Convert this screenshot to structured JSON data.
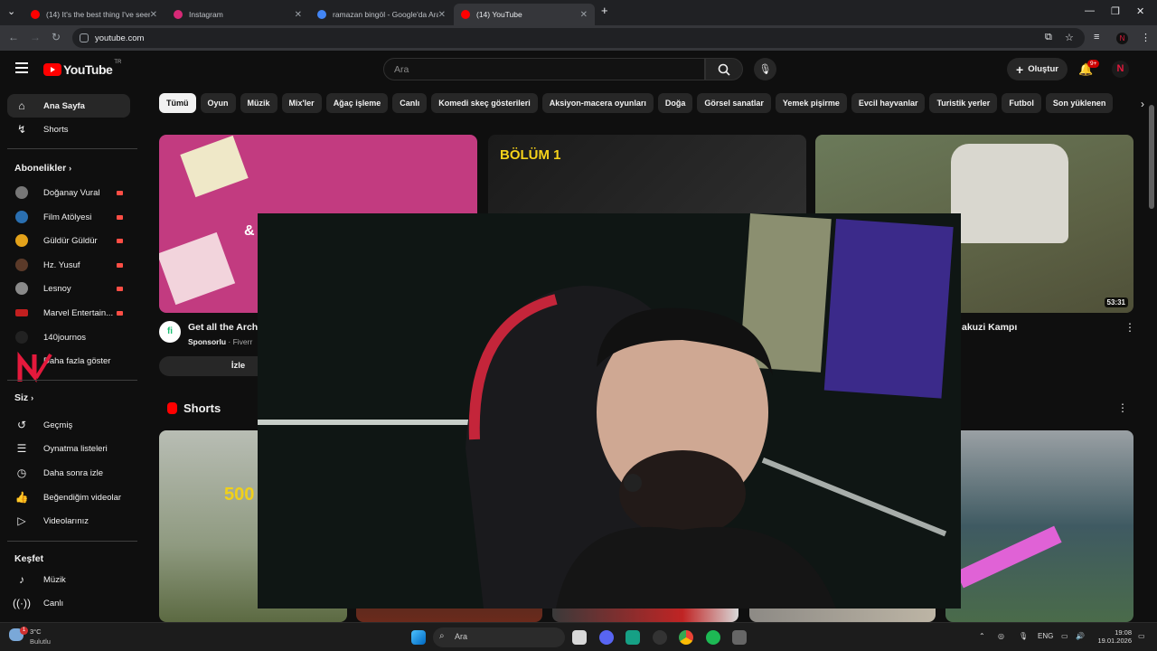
{
  "browser": {
    "tabs": [
      {
        "title": "(14) It's the best thing I've seen",
        "favicon_color": "#ff0000",
        "active": false
      },
      {
        "title": "Instagram",
        "favicon_color": "#d62976",
        "active": false
      },
      {
        "title": "ramazan bingöl - Google'da Ara",
        "favicon_color": "#4285f4",
        "active": false
      },
      {
        "title": "(14) YouTube",
        "favicon_color": "#ff0000",
        "active": true
      }
    ],
    "url": "youtube.com"
  },
  "youtube": {
    "logo": "YouTube",
    "country": "TR",
    "search_placeholder": "Ara",
    "create_label": "Oluştur",
    "notification_badge": "9+",
    "chips": [
      "Tümü",
      "Oyun",
      "Müzik",
      "Mix'ler",
      "Ağaç işleme",
      "Canlı",
      "Komedi skeç gösterileri",
      "Aksiyon-macera oyunları",
      "Doğa",
      "Görsel sanatlar",
      "Yemek pişirme",
      "Evcil hayvanlar",
      "Turistik yerler",
      "Futbol",
      "Son yüklenen"
    ],
    "sidebar": {
      "main": [
        {
          "label": "Ana Sayfa",
          "icon": "home-icon"
        },
        {
          "label": "Shorts",
          "icon": "shorts-icon"
        }
      ],
      "subs_header": "Abonelikler",
      "subs": [
        {
          "label": "Doğanay Vural",
          "color": "#777777"
        },
        {
          "label": "Film Atölyesi",
          "color": "#2a6fb0"
        },
        {
          "label": "Güldür Güldür",
          "color": "#e3a21a"
        },
        {
          "label": "Hz. Yusuf",
          "color": "#5b3a29"
        },
        {
          "label": "Lesnoy",
          "color": "#8a8a8a"
        },
        {
          "label": "Marvel Entertain...",
          "color": "#c21f1f"
        },
        {
          "label": "140journos",
          "color": "#222222"
        }
      ],
      "more": "Daha fazla göster",
      "you_header": "Siz",
      "you": [
        {
          "label": "Geçmiş",
          "icon": "history-icon"
        },
        {
          "label": "Oynatma listeleri",
          "icon": "playlists-icon"
        },
        {
          "label": "Daha sonra izle",
          "icon": "watch-later-icon"
        },
        {
          "label": "Beğendiğim videolar",
          "icon": "liked-videos-icon"
        },
        {
          "label": "Videolarınız",
          "icon": "your-videos-icon"
        }
      ],
      "explore_header": "Keşfet",
      "explore": [
        {
          "label": "Müzik",
          "icon": "music-icon"
        },
        {
          "label": "Canlı",
          "icon": "live-icon"
        }
      ]
    },
    "videos": {
      "ad_title": "Get all the Archi",
      "ad_sponsor": "Sponsorlu",
      "ad_channel": "· Fiverr",
      "ad_button": "İzle",
      "ad_thumb_text": "&",
      "v2_thumb_text": "BÖLÜM 1",
      "v3_title": "akuzi Kampı",
      "v3_duration": "53:31",
      "shorts_header": "Shorts",
      "short_number": "500"
    }
  },
  "taskbar": {
    "weather_temp": "3°C",
    "weather_desc": "Bulutlu",
    "weather_badge": "1",
    "search": "Ara",
    "lang": "ENG",
    "time": "19:08",
    "date": "19.01.2026"
  }
}
